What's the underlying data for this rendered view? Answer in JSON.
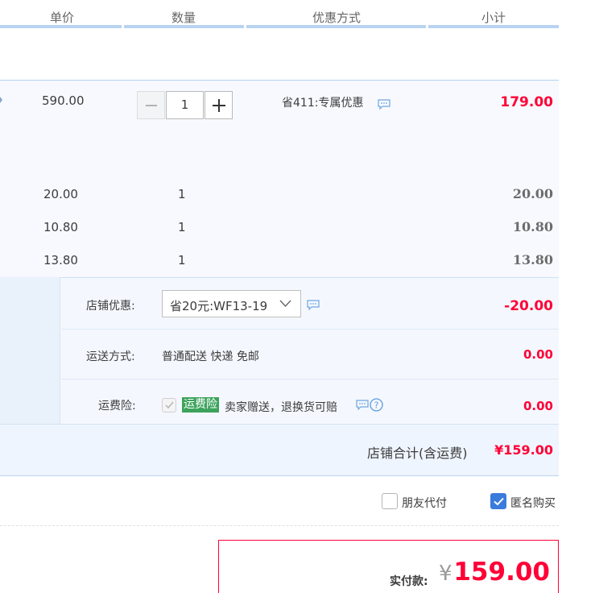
{
  "header": {
    "col_unit_price": "单价",
    "col_quantity": "数量",
    "col_discount": "优惠方式",
    "col_subtotal": "小计"
  },
  "main_item": {
    "unit_price": "590.00",
    "quantity": "1",
    "discount_text": "省411:专属优惠",
    "subtotal": "179.00"
  },
  "sub_items": [
    {
      "unit_price": "20.00",
      "quantity": "1",
      "subtotal": "20.00"
    },
    {
      "unit_price": "10.80",
      "quantity": "1",
      "subtotal": "10.80"
    },
    {
      "unit_price": "13.80",
      "quantity": "1",
      "subtotal": "13.80"
    }
  ],
  "shop": {
    "coupon_label": "店铺优惠:",
    "coupon_selected": "省20元:WF13-19",
    "coupon_amount": "-20.00",
    "shipping_label": "运送方式:",
    "shipping_value": "普通配送 快递 免邮",
    "shipping_amount": "0.00",
    "insurance_label": "运费险:",
    "insurance_badge": "运费险",
    "insurance_desc": "卖家赠送，退换货可赔",
    "insurance_amount": "0.00",
    "shop_total_label": "店铺合计(含运费)",
    "shop_total_value": "¥159.00"
  },
  "options": {
    "friend_pay_label": "朋友代付",
    "friend_pay_checked": false,
    "anonymous_label": "匿名购买",
    "anonymous_checked": true
  },
  "payment": {
    "label": "实付款:",
    "currency": "¥",
    "amount": "159.00"
  },
  "colors": {
    "accent_red": "#ff0036",
    "header_line": "#b9d3f2",
    "checkbox_blue": "#3a7bdc",
    "insurance_green": "#3da35c"
  },
  "icons": [
    "chat-icon",
    "help-icon",
    "chevron-down-icon",
    "minus-icon",
    "plus-icon",
    "check-icon"
  ]
}
